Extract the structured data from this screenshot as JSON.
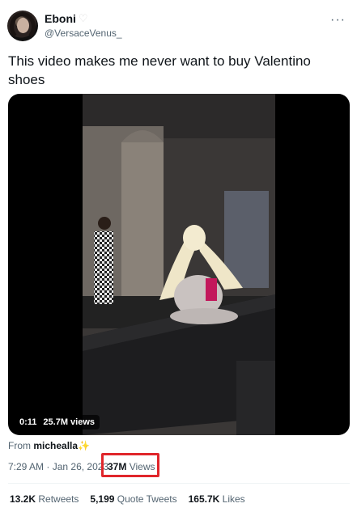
{
  "author": {
    "display_name": "Eboni",
    "handle": "@VersaceVenus_",
    "badge_icon": "heart-icon"
  },
  "tweet": {
    "text": "This video makes me never want to buy Valentino shoes"
  },
  "media": {
    "elapsed": "0:11",
    "views": "25.7M views"
  },
  "attribution": {
    "prefix": "From",
    "source": "micheallа",
    "emoji": "✨"
  },
  "meta": {
    "time": "7:29 AM",
    "separator": "·",
    "date": "Jan 26, 2023",
    "views_count": "37M",
    "views_label": "Views"
  },
  "stats": {
    "retweets_count": "13.2K",
    "retweets_label": "Retweets",
    "quotes_count": "5,199",
    "quotes_label": "Quote Tweets",
    "likes_count": "165.7K",
    "likes_label": "Likes"
  },
  "colors": {
    "highlight": "#e0262b",
    "secondary_text": "#536471"
  }
}
